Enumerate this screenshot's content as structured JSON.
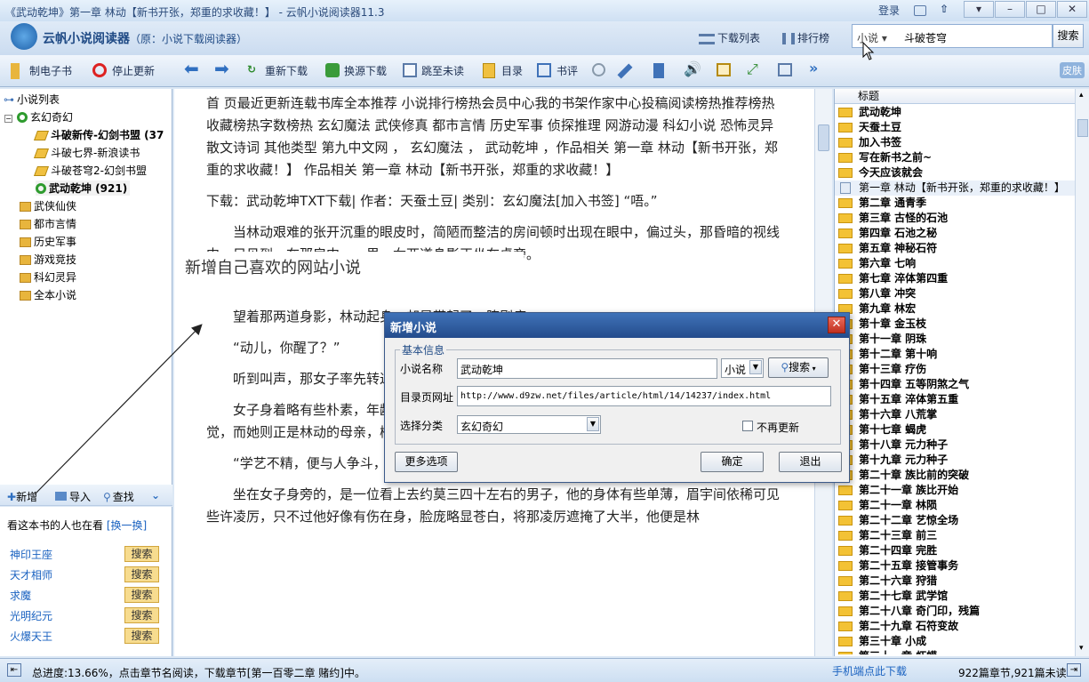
{
  "window": {
    "title": "《武动乾坤》第一章 林动【新书开张，郑重的求收藏！】 - 云帆小说阅读器11.3",
    "login": "登录",
    "minimize": "–",
    "maximize": "□",
    "close": "✕"
  },
  "banner": {
    "app_name": "云帆小说阅读器",
    "app_sub": "（原：小说下载阅读器）",
    "download_list": "下载列表",
    "ranking": "排行榜",
    "search_scope": "小说 ▾",
    "search_value": "斗破苍穹",
    "search_button": "搜索"
  },
  "toolbar": {
    "make_ebook": "制电子书",
    "stop_update": "停止更新",
    "redownload": "重新下载",
    "switch_download": "换源下载",
    "jump_unread": "跳至未读",
    "toc": "目录",
    "review": "书评",
    "skin_label": "皮肤"
  },
  "tree": {
    "root": "小说列表",
    "category": "玄幻奇幻",
    "books": [
      "斗破新传-幻剑书盟 (37",
      "斗破七界-新浪读书",
      "斗破苍穹2-幻剑书盟",
      "武动乾坤 (921)"
    ],
    "folders": [
      "武侠仙侠",
      "都市言情",
      "历史军事",
      "游戏竞技",
      "科幻灵异",
      "全本小说"
    ]
  },
  "left_tools": {
    "add": "新增",
    "import": "导入",
    "find": "查找"
  },
  "also_read": {
    "title": "看这本书的人也在看",
    "change": "[换一换]",
    "items": [
      "神印王座",
      "天才相师",
      "求魔",
      "光明纪元",
      "火爆天王"
    ],
    "search_label": "搜索"
  },
  "reader": {
    "nav_text": "首  页最近更新连载书库全本推荐 小说排行榜热会员中心我的书架作家中心投稿阅读榜热推荐榜热收藏榜热字数榜热 玄幻魔法 武侠修真 都市言情 历史军事 侦探推理 网游动漫 科幻小说 恐怖灵异 散文诗词 其他类型 第九中文网 ， 玄幻魔法 ， 武动乾坤 ，作品相关 第一章 林动【新书开张，郑重的求收藏！】 作品相关 第一章 林动【新书开张，郑重的求收藏！】",
    "download_line": "下载：武动乾坤TXT下载| 作者：天蚕土豆| 类别：玄幻魔法[加入书签]      “唔。”",
    "para1": "当林动艰难的张开沉重的眼皮时，简陋而整洁的房间顿时出现在眼中，偏过头，那昏暗的视线中，只见到，在那房中，一男一女两道身影正坐在桌旁。",
    "para2": "“爹，娘…”",
    "para3": "望着那两道身影，林动起身，却是带起了一阵剧痛。",
    "para4": "“动儿，你醒了？”",
    "para5": "听到叫声，那女子率先转过头来，急忙起身。",
    "para6": "女子身着略有些朴素，年龄看上去约莫三十左右，其脸颊略显秀美，给人一种温婉柔和的感觉，而她则正是林动的母亲，柳妍。",
    "para7": "“学艺不精，便与人争斗，自讨苦吃。”",
    "para8": "坐在女子身旁的，是一位看上去约莫三四十左右的男子，他的身体有些单薄，眉宇间依稀可见些许凌厉，只不过他好像有伤在身，脸庞略显苍白，将那凌厉遮掩了大半，他便是林"
  },
  "hint": "新增自己喜欢的网站小说",
  "dialog": {
    "title": "新增小说",
    "group": "基本信息",
    "name_label": "小说名称",
    "name_value": "武动乾坤",
    "type_value": "小说",
    "search_button": "搜索",
    "url_label": "目录页网址",
    "url_value": "http://www.d9zw.net/files/article/html/14/14237/index.html",
    "category_label": "选择分类",
    "category_value": "玄幻奇幻",
    "no_update": "不再更新",
    "more_options": "更多选项",
    "ok": "确定",
    "cancel": "退出",
    "close": "✕"
  },
  "chapters": {
    "header": "标题",
    "items": [
      "武动乾坤",
      "天蚕土豆",
      "加入书签",
      "写在新书之前~",
      "今天应该就会",
      "第一章 林动【新书开张，郑重的求收藏！】",
      "第二章 通青季",
      "第三章 古怪的石池",
      "第四章 石池之秘",
      "第五章 神秘石符",
      "第六章 七响",
      "第七章 淬体第四重",
      "第八章 冲突",
      "第九章 林宏",
      "第十章 金玉枝",
      "第十一章 阴珠",
      "第十二章 第十响",
      "第十三章 疗伤",
      "第十四章 五等阴煞之气",
      "第十五章 淬体第五重",
      "第十六章 八荒掌",
      "第十七章 蝎虎",
      "第十八章 元力种子",
      "第十九章 元力种子",
      "第二十章 族比前的突破",
      "第二十一章 族比开始",
      "第二十一章 林陨",
      "第二十二章 艺惊全场",
      "第二十三章 前三",
      "第二十四章 完胜",
      "第二十五章 接管事务",
      "第二十六章 狩猎",
      "第二十七章 武学馆",
      "第二十八章 奇门印，残篇",
      "第二十九章 石符变故",
      "第三十章 小成",
      "第三十一章 虾蟆"
    ]
  },
  "status": {
    "left": "总进度:13.66%，点击章节名阅读，下载章节[第一百零二章 赌约]中。",
    "mobile": "手机端点此下载",
    "right": "922篇章节,921篇未读"
  },
  "colors": {
    "accent": "#1f4a85",
    "link": "#1a62c0",
    "dialog_title": "#2f5fa3"
  }
}
